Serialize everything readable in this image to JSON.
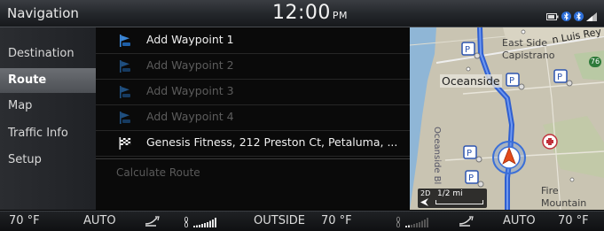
{
  "status_bar": {
    "title": "Navigation",
    "time": "12:00",
    "ampm": "PM",
    "icons": [
      "battery-icon",
      "bluetooth-icon",
      "signal-icon"
    ]
  },
  "menu": {
    "items": [
      {
        "label": "Destination",
        "selected": false
      },
      {
        "label": "Route",
        "selected": true
      },
      {
        "label": "Map",
        "selected": false
      },
      {
        "label": "Traffic Info",
        "selected": false
      },
      {
        "label": "Setup",
        "selected": false
      }
    ]
  },
  "route_list": {
    "rows": [
      {
        "label": "Add Waypoint 1",
        "icon": "waypoint-flag-icon",
        "enabled": true
      },
      {
        "label": "Add Waypoint 2",
        "icon": "waypoint-flag-icon",
        "enabled": false
      },
      {
        "label": "Add Waypoint 3",
        "icon": "waypoint-flag-icon",
        "enabled": false
      },
      {
        "label": "Add Waypoint 4",
        "icon": "waypoint-flag-icon",
        "enabled": false
      },
      {
        "label": "Genesis Fitness, 212 Preston Ct, Petaluma, ...",
        "icon": "checkered-flag-icon",
        "enabled": true
      }
    ],
    "calculate_route": "Calculate Route"
  },
  "map": {
    "labels": {
      "oceanside": "Oceanside",
      "east_side": "East Side",
      "capistrano": "Capistrano",
      "luis_rey": "n Luis Rey R",
      "fire": "Fire",
      "mountain": "Mountain",
      "blvd": "Oceanside Bl",
      "route_badge": "76"
    },
    "scale": {
      "mode": "2D",
      "distance": "1/2 mi"
    },
    "colors": {
      "route": "#2f5fd0",
      "land": "#c7c2b1",
      "water": "#8fb6d6"
    }
  },
  "climate": {
    "left_temp": "70 °F",
    "left_mode": "AUTO",
    "outside_label": "OUTSIDE",
    "outside_temp": "70 °F",
    "right_mode": "AUTO",
    "right_temp": "70 °F",
    "fan_level_left": 1.0,
    "fan_level_right": 0.2
  }
}
